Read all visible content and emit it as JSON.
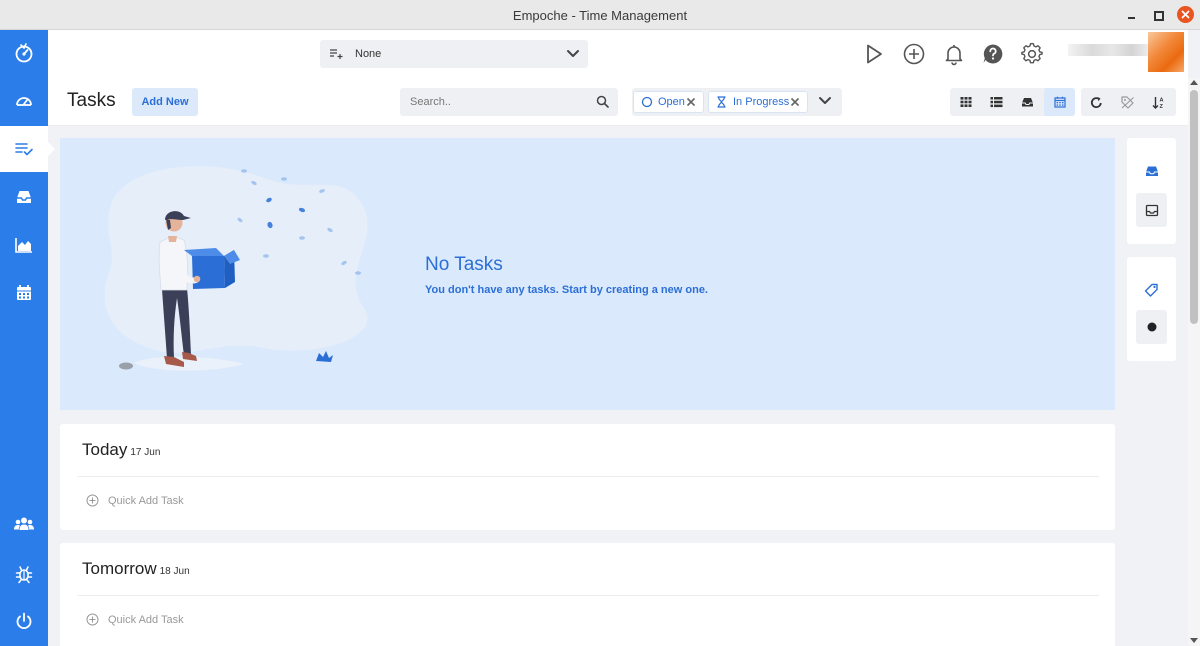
{
  "window": {
    "title": "Empoche - Time Management"
  },
  "topbar": {
    "project_label": "None"
  },
  "header": {
    "title": "Tasks",
    "add_new_label": "Add New",
    "search_placeholder": "Search..",
    "filters": [
      {
        "label": "Open"
      },
      {
        "label": "In Progress"
      }
    ]
  },
  "empty_state": {
    "title": "No Tasks",
    "subtitle": "You don't have any tasks. Start by creating a new one."
  },
  "days": [
    {
      "label": "Today",
      "date": "17 Jun",
      "quick_add": "Quick Add Task"
    },
    {
      "label": "Tomorrow",
      "date": "18 Jun",
      "quick_add": "Quick Add Task"
    }
  ],
  "colors": {
    "brand": "#2b7de9",
    "accent_text": "#2b6fd6",
    "empty_bg": "#dbe9fc",
    "close_button": "#e95420"
  },
  "icons": {
    "sidebar": [
      "logo-icon",
      "dashboard-icon",
      "tasks-icon",
      "inbox-icon",
      "reports-icon",
      "calendar-icon",
      "team-icon",
      "bug-icon",
      "power-icon"
    ],
    "topbar": [
      "play-icon",
      "add-circle-icon",
      "bell-icon",
      "help-icon",
      "gear-icon"
    ],
    "views": [
      "grid-view-icon",
      "list-view-icon",
      "inbox-view-icon",
      "calendar-view-icon"
    ],
    "tools": [
      "refresh-icon",
      "tag-filter-icon",
      "sort-icon"
    ]
  }
}
